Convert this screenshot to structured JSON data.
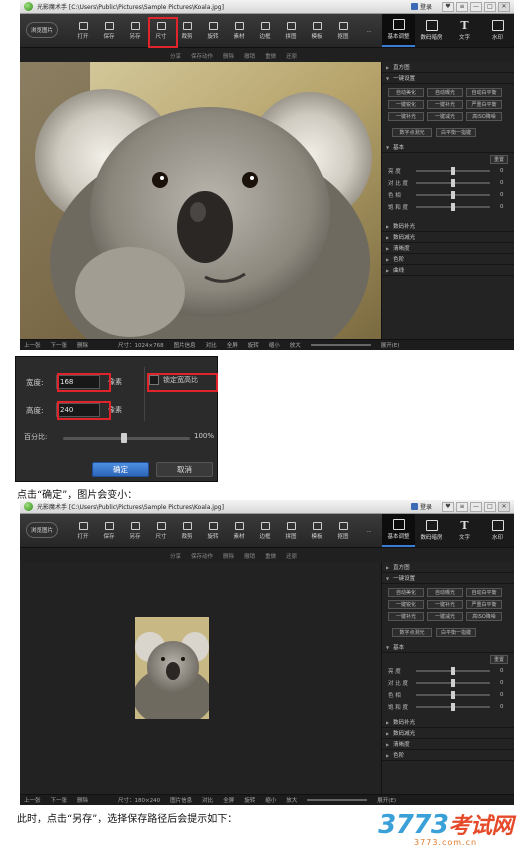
{
  "window": {
    "title": "光影魔术手 [C:\\Users\\Public\\Pictures\\Sample Pictures\\Koala.jpg]",
    "login": "登录",
    "controls": [
      "♥",
      "≡",
      "—",
      "□",
      "✕"
    ]
  },
  "toolbar": {
    "browse_label": "浏览图片",
    "tools": [
      {
        "label": "打开",
        "icon": "open-icon"
      },
      {
        "label": "保存",
        "icon": "save-icon"
      },
      {
        "label": "另存",
        "icon": "save-as-icon"
      },
      {
        "label": "尺寸",
        "icon": "resize-icon"
      },
      {
        "label": "裁剪",
        "icon": "crop-icon"
      },
      {
        "label": "旋转",
        "icon": "rotate-icon"
      },
      {
        "label": "素材",
        "icon": "material-icon"
      },
      {
        "label": "边框",
        "icon": "border-icon"
      },
      {
        "label": "拼图",
        "icon": "collage-icon"
      },
      {
        "label": "模板",
        "icon": "template-icon"
      },
      {
        "label": "抠图",
        "icon": "cutout-icon"
      },
      {
        "label": "...",
        "icon": "more-icon"
      }
    ],
    "modes": [
      {
        "label": "基本调整",
        "icon": "adjust-icon"
      },
      {
        "label": "数码暗房",
        "icon": "camera-icon"
      },
      {
        "label": "文字",
        "icon": "text-icon",
        "glyph": "T"
      },
      {
        "label": "水印",
        "icon": "watermark-icon"
      }
    ]
  },
  "subbar": {
    "share": "分享",
    "save_action": "保存动作",
    "delete": "删除",
    "undo": "撤销",
    "redo": "重做",
    "restore": "还原"
  },
  "panel": {
    "histogram": "直方图",
    "one_click": "一键设置",
    "one_click_buttons": [
      "自动美化",
      "自动曝光",
      "自动白平衡",
      "一键锐化",
      "一键补光",
      "严重白平衡",
      "一键补光",
      "一键减光",
      "高ISO降噪"
    ],
    "extra_buttons": [
      "数字点测光",
      "白平衡一指键"
    ],
    "basic": "基本",
    "reset": "重置",
    "sliders": [
      {
        "label": "亮  度",
        "value": "0"
      },
      {
        "label": "对 比 度",
        "value": "0"
      },
      {
        "label": "色    相",
        "value": "0"
      },
      {
        "label": "饱 和 度",
        "value": "0"
      }
    ],
    "sections": [
      "数码补光",
      "数码减光",
      "清晰度",
      "色阶",
      "曲线"
    ]
  },
  "status1": {
    "prev": "上一张",
    "next": "下一张",
    "delete": "删除",
    "size": "尺寸：1024×768",
    "info": "图片信息",
    "compare": "对比",
    "fullscreen": "全屏",
    "rotate": "旋转",
    "shrink": "缩小",
    "enlarge": "放大",
    "expand": "展开(E)"
  },
  "status2": {
    "prev": "上一张",
    "next": "下一张",
    "delete": "删除",
    "size": "尺寸：180×240",
    "info": "图片信息",
    "compare": "对比",
    "fullscreen": "全屏",
    "rotate": "旋转",
    "shrink": "缩小",
    "enlarge": "放大",
    "expand": "展开(E)"
  },
  "dialog": {
    "width_label": "宽度:",
    "width_value": "168",
    "height_label": "高度:",
    "height_value": "240",
    "unit": "像素",
    "lock_ratio": "锁定宽高比",
    "percent_label": "百分比:",
    "percent_value": "100%",
    "percent_level": 0.48,
    "ok": "确定",
    "cancel": "取消"
  },
  "captions": {
    "c1": "点击“确定”，图片会变小：",
    "c2": "此时，点击“另存”，选择保存路径后会提示如下："
  },
  "watermark": {
    "main_num": "3773",
    "main_cn": "考试网",
    "sub": "3773.com.cn"
  },
  "colors": {
    "highlight": "#e0242b",
    "accent": "#3a7bd5"
  }
}
